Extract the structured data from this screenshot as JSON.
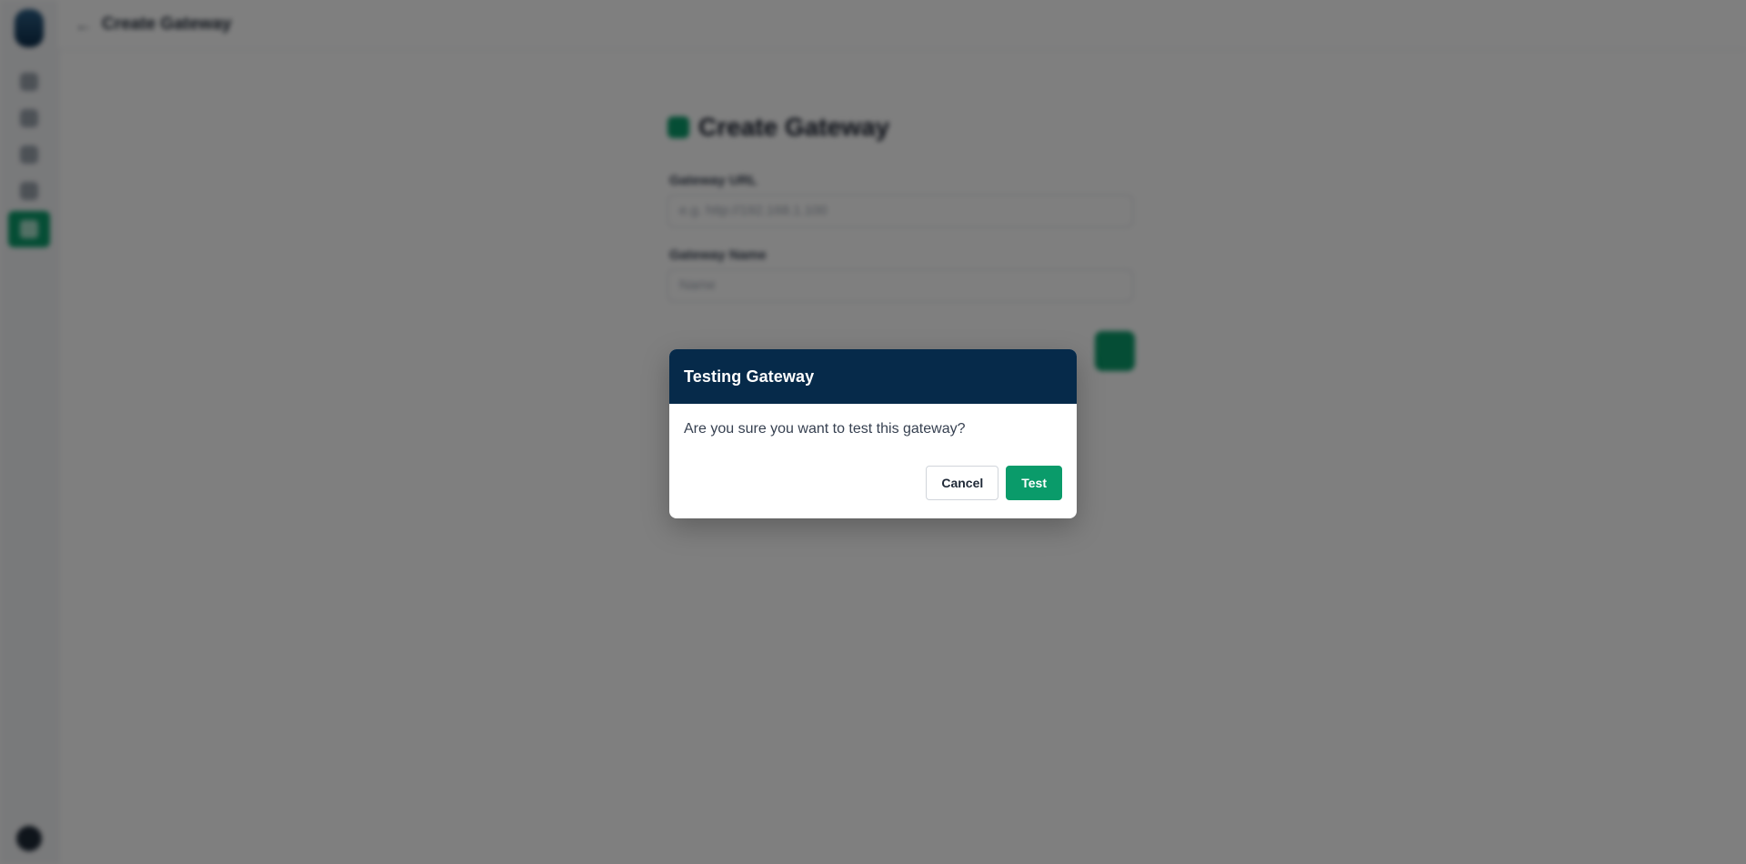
{
  "topbar": {
    "back_icon": "arrow-left-icon",
    "title": "Create Gateway"
  },
  "sidebar": {
    "items": [
      {
        "icon": "home-icon"
      },
      {
        "icon": "grid-icon"
      },
      {
        "icon": "check-icon"
      },
      {
        "icon": "user-icon"
      },
      {
        "icon": "gateway-icon",
        "active": true
      }
    ]
  },
  "form": {
    "title": "Create Gateway",
    "fields": [
      {
        "label": "Gateway URL",
        "placeholder": "e.g. http://192.168.1.100"
      },
      {
        "label": "Gateway Name",
        "placeholder": "Name"
      }
    ]
  },
  "modal": {
    "title": "Testing Gateway",
    "message": "Are you sure you want to test this gateway?",
    "cancel_label": "Cancel",
    "confirm_label": "Test"
  },
  "colors": {
    "modal_header": "#062a4a",
    "primary_green": "#0a9b6a",
    "overlay": "rgba(0,0,0,0.5)"
  }
}
